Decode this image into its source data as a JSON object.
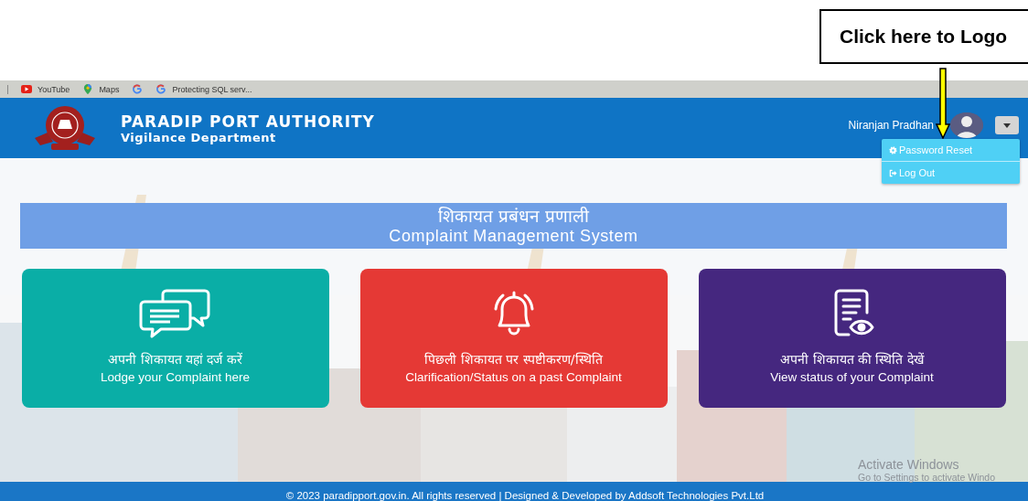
{
  "callout": {
    "text": "Click here to Logo"
  },
  "bookmarks": [
    {
      "kind": "youtube",
      "label": "YouTube"
    },
    {
      "kind": "maps",
      "label": "Maps"
    },
    {
      "kind": "google"
    },
    {
      "kind": "google",
      "label": "Protecting SQL serv..."
    }
  ],
  "header": {
    "title": "PARADIP PORT AUTHORITY",
    "subtitle": "Vigilance Department",
    "user_name": "Niranjan Pradhan"
  },
  "user_menu": {
    "expanded": true,
    "items": [
      {
        "kind": "reset",
        "label": "Password Reset"
      },
      {
        "kind": "logout",
        "label": "Log Out"
      }
    ]
  },
  "system_title": {
    "hindi": "शिकायत प्रबंधन प्रणाली",
    "english": "Complaint Management System"
  },
  "cards": [
    {
      "kind": "chat",
      "color": "#0aaea6",
      "hindi": "अपनी शिकायत यहां दर्ज करें",
      "english": "Lodge your Complaint here"
    },
    {
      "kind": "bell",
      "color": "#e53935",
      "hindi": "पिछली शिकायत पर स्पष्टीकरण/स्थिति",
      "english": "Clarification/Status on a past Complaint"
    },
    {
      "kind": "document",
      "color": "#45277f",
      "hindi": "अपनी शिकायत की स्थिति देखें",
      "english": "View status of your Complaint"
    }
  ],
  "footer": {
    "text": "© 2023 paradipport.gov.in. All rights reserved | Designed & Developed by Addsoft Technologies Pvt.Ltd"
  },
  "os_notice": {
    "title": "Activate Windows",
    "subtitle": "Go to Settings to activate Windo"
  }
}
